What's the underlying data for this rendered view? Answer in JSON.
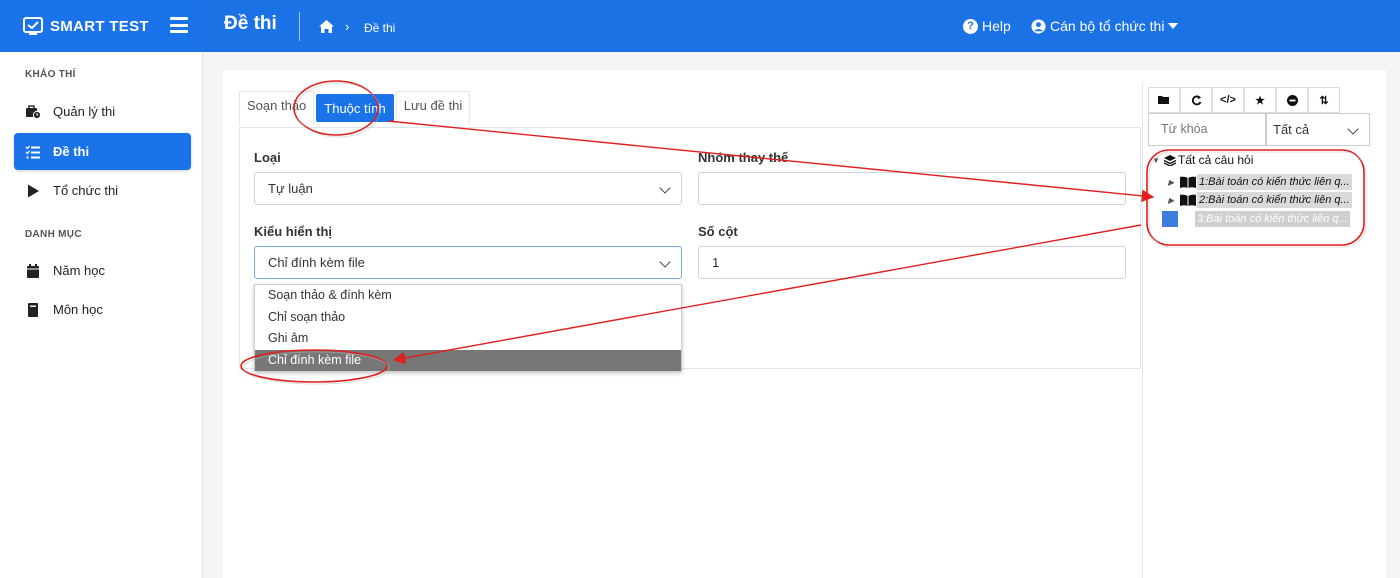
{
  "brand": {
    "name": "SMART TEST"
  },
  "header": {
    "page_title": "Đề thi",
    "breadcrumb_item": "Đề thi",
    "help_label": "Help",
    "user_label": "Cán bộ tổ chức thi"
  },
  "sidebar": {
    "section1": "KHẢO THÍ",
    "section2": "DANH MỤC",
    "items": [
      {
        "label": "Quản lý thi",
        "icon": "briefcase-clock-icon",
        "active": false
      },
      {
        "label": "Đề thi",
        "icon": "list-check-icon",
        "active": true
      },
      {
        "label": "Tổ chức thi",
        "icon": "play-icon",
        "active": false
      },
      {
        "label": "Năm học",
        "icon": "calendar-icon",
        "active": false
      },
      {
        "label": "Môn học",
        "icon": "book-icon",
        "active": false
      }
    ]
  },
  "tabs": [
    {
      "label": "Soạn thảo",
      "active": false
    },
    {
      "label": "Thuộc tính",
      "active": true
    },
    {
      "label": "Lưu đề thi",
      "active": false
    }
  ],
  "form": {
    "loai_label": "Loại",
    "loai_value": "Tự luận",
    "nhom_label": "Nhóm thay thế",
    "nhom_value": "",
    "kieu_label": "Kiểu hiển thị",
    "kieu_value": "Chỉ đính kèm file",
    "socot_label": "Số cột",
    "socot_value": "1",
    "kieu_options": [
      "Soạn thảo & đính kèm",
      "Chỉ soạn thảo",
      "Ghi âm",
      "Chỉ đính kèm file"
    ],
    "kieu_selected_index": 3
  },
  "right_panel": {
    "toolbar_icons": [
      "folder-open-icon",
      "refresh-icon",
      "code-icon",
      "star-icon",
      "minus-circle-icon",
      "sort-icon"
    ],
    "keyword_placeholder": "Từ khóa",
    "filter_value": "Tất cả",
    "tree_root": "Tất cả câu hỏi",
    "tree_items": [
      "1:Bài toán có kiến thức liên q...",
      "2:Bài toán có kiến thức liên q...",
      "3:Bài toán có kiến thức liên q..."
    ]
  },
  "colors": {
    "primary": "#1a73e8",
    "annotation": "#e02020",
    "selected_option": "#777777"
  }
}
